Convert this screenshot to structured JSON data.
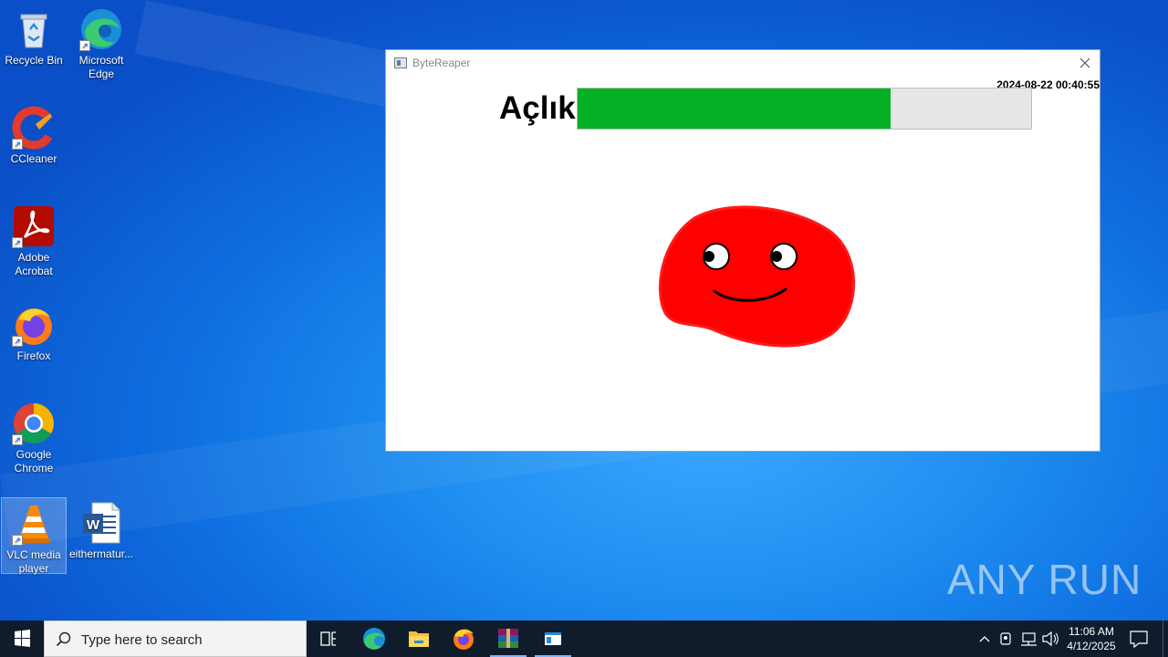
{
  "desktop": {
    "icons": [
      {
        "label": "Recycle Bin",
        "icon": "recycle-bin-icon"
      },
      {
        "label": "Microsoft Edge",
        "icon": "edge-icon"
      },
      {
        "label": "CCleaner",
        "icon": "ccleaner-icon"
      },
      {
        "label": "Adobe Acrobat",
        "icon": "acrobat-icon"
      },
      {
        "label": "Firefox",
        "icon": "firefox-icon"
      },
      {
        "label": "Google Chrome",
        "icon": "chrome-icon"
      },
      {
        "label": "VLC media player",
        "icon": "vlc-icon"
      },
      {
        "label": "eithermatur...",
        "icon": "word-document-icon"
      }
    ],
    "watermark": "ANY RUN"
  },
  "window": {
    "title": "ByteReaper",
    "timestamp": "2024-08-22 00:40:55",
    "hunger_label": "Açlık",
    "hunger_level_percent": 69,
    "colors": {
      "bar_fill": "#06b025",
      "bar_track": "#e6e6e6",
      "pet_body": "#ff0000"
    }
  },
  "taskbar": {
    "search_placeholder": "Type here to search",
    "pinned": [
      "task-view-icon",
      "edge-icon",
      "file-explorer-icon",
      "firefox-icon",
      "winrar-icon",
      "bytereaper-app-icon"
    ],
    "time": "11:06 AM",
    "date": "4/12/2025"
  }
}
